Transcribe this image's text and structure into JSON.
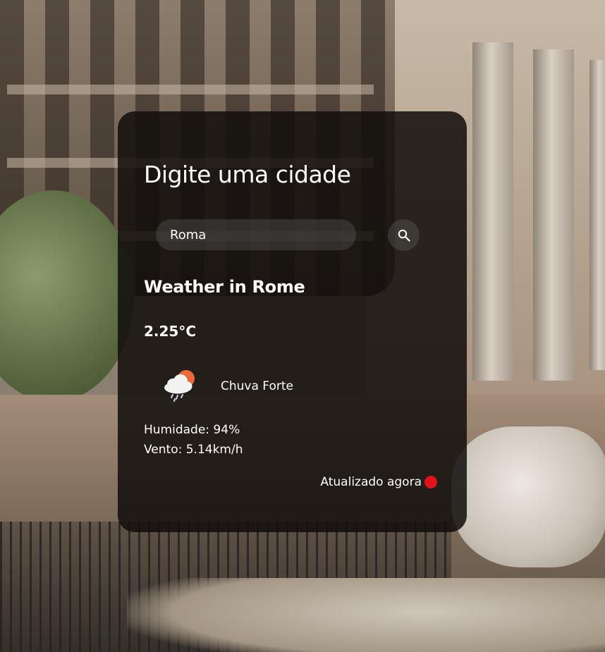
{
  "card": {
    "title": "Digite uma cidade",
    "search": {
      "value": "Roma",
      "button_icon": "search-icon"
    },
    "city_heading": "Weather in Rome",
    "temperature": "2.25°C",
    "weather_icon": "cloud-rain-sun-icon",
    "condition": "Chuva Forte",
    "humidity": "Humidade: 94%",
    "wind": "Vento: 5.14km/h",
    "updated": {
      "label": "Atualizado agora",
      "dot_color": "#e3111a"
    }
  },
  "colors": {
    "card_background": "rgba(18,14,12,0.86)",
    "text": "#ffffff",
    "status_dot": "#e3111a"
  }
}
